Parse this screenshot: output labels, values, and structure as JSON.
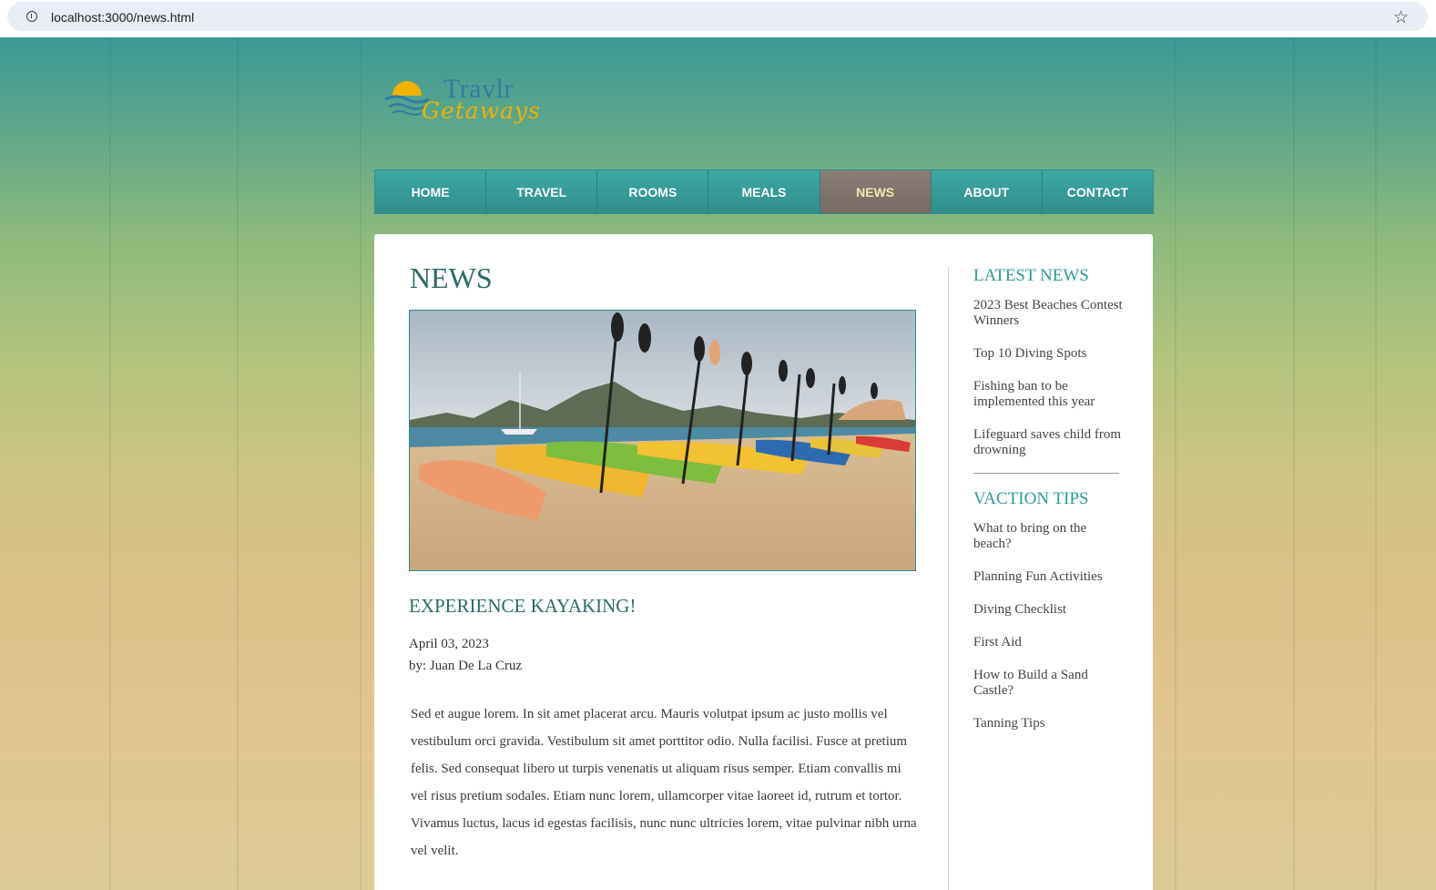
{
  "browser": {
    "url": "localhost:3000/news.html"
  },
  "logo": {
    "line1": "Travlr",
    "line2": "Getaways"
  },
  "nav": {
    "items": [
      {
        "label": "HOME",
        "active": false
      },
      {
        "label": "TRAVEL",
        "active": false
      },
      {
        "label": "ROOMS",
        "active": false
      },
      {
        "label": "MEALS",
        "active": false
      },
      {
        "label": "NEWS",
        "active": true
      },
      {
        "label": "ABOUT",
        "active": false
      },
      {
        "label": "CONTACT",
        "active": false
      }
    ]
  },
  "main": {
    "title": "NEWS",
    "article": {
      "title": "EXPERIENCE KAYAKING!",
      "date": "April 03, 2023",
      "author": "by: Juan De La Cruz",
      "body": "Sed et augue lorem. In sit amet placerat arcu. Mauris volutpat ipsum ac justo mollis vel vestibulum orci gravida. Vestibulum sit amet porttitor odio. Nulla facilisi. Fusce at pretium felis. Sed consequat libero ut turpis venenatis ut aliquam risus semper. Etiam convallis mi vel risus pretium sodales. Etiam nunc lorem, ullamcorper vitae laoreet id, rutrum et tortor. Vivamus luctus, lacus id egestas facilisis, nunc nunc ultricies lorem, vitae pulvinar nibh urna vel velit."
    }
  },
  "sidebar": {
    "latest_news": {
      "heading": "LATEST NEWS",
      "items": [
        "2023 Best Beaches Contest Winners",
        "Top 10 Diving Spots",
        "Fishing ban to be implemented this year",
        "Lifeguard saves child from drowning"
      ]
    },
    "tips": {
      "heading": "VACTION TIPS",
      "items": [
        "What to bring on the beach?",
        "Planning Fun Activities",
        "Diving Checklist",
        "First Aid",
        "How to Build a Sand Castle?",
        "Tanning Tips"
      ]
    }
  },
  "colors": {
    "accent": "#2e8d89",
    "nav_active": "#7f726b",
    "heading": "#2c6a66"
  }
}
